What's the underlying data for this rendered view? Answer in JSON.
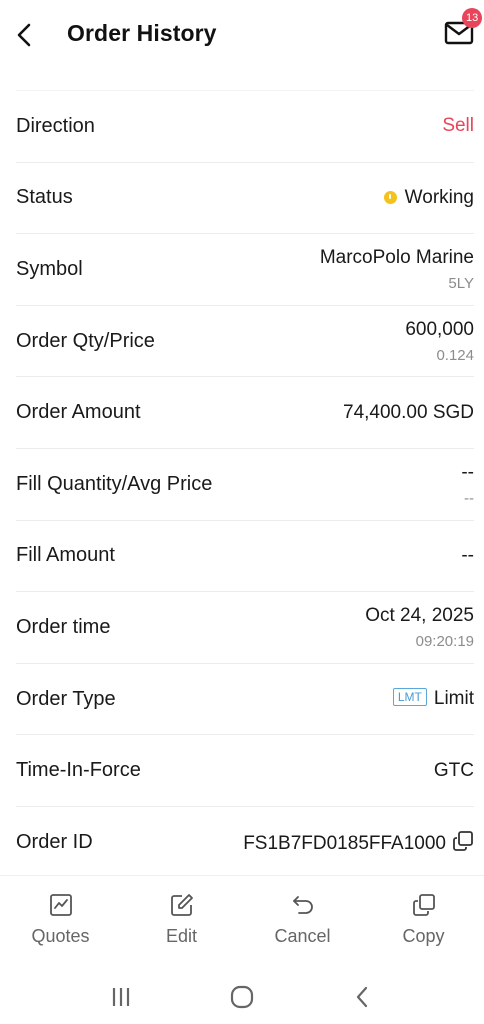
{
  "header": {
    "title": "Order History",
    "mail_badge": "13"
  },
  "rows": [
    {
      "label": "Direction",
      "value": "Sell"
    },
    {
      "label": "Status",
      "value": "Working"
    },
    {
      "label": "Symbol",
      "value": "MarcoPolo Marine",
      "sub": "5LY"
    },
    {
      "label": "Order Qty/Price",
      "value": "600,000",
      "sub": "0.124"
    },
    {
      "label": "Order Amount",
      "value": "74,400.00 SGD"
    },
    {
      "label": "Fill Quantity/Avg Price",
      "value": "--",
      "sub": "--"
    },
    {
      "label": "Fill Amount",
      "value": "--"
    },
    {
      "label": "Order time",
      "value": "Oct 24, 2025",
      "sub": "09:20:19"
    },
    {
      "label": "Order Type",
      "tag": "LMT",
      "value": "Limit"
    },
    {
      "label": "Time-In-Force",
      "value": "GTC"
    },
    {
      "label": "Order ID",
      "value": "FS1B7FD0185FFA1000"
    }
  ],
  "toolbar": {
    "quotes": "Quotes",
    "edit": "Edit",
    "cancel": "Cancel",
    "copy": "Copy"
  },
  "colors": {
    "sell": "#e8445a",
    "status_working": "#f4c21b",
    "badge": "#e8445a",
    "lmt": "#4a9bd0"
  },
  "icons": [
    "back-arrow-icon",
    "mail-icon",
    "clock-icon",
    "copy-icon",
    "chart-icon",
    "edit-icon",
    "undo-icon",
    "copy-icon",
    "recents-icon",
    "home-icon",
    "back-icon"
  ]
}
